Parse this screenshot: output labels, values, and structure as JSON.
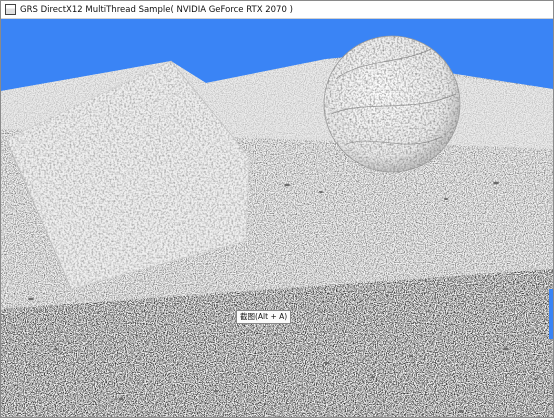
{
  "window": {
    "title": "GRS DirectX12 MultiThread Sample( NVIDIA GeForce RTX 2070 )",
    "icon": "app-window-icon"
  },
  "viewport": {
    "sky_color": "#3a84f5",
    "ground_color": "#f4f4f4",
    "tooltip": "截图(Alt + A)"
  }
}
